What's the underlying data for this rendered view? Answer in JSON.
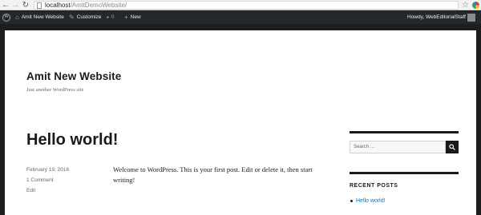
{
  "browser": {
    "url_host": "localhost",
    "url_path": "/AmitDemoWebsite/",
    "back_icon": "back-arrow-icon",
    "forward_icon": "forward-arrow-icon",
    "reload_icon": "reload-icon",
    "star_icon": "bookmark-star-icon"
  },
  "adminbar": {
    "site_name": "Amit New Website",
    "customize": "Customize",
    "comments_count": "0",
    "new": "New",
    "howdy": "Howdy, WebEditorialStaff"
  },
  "site": {
    "title": "Amit New Website",
    "description": "Just another WordPress site"
  },
  "post": {
    "title": "Hello world!",
    "date": "February 19, 2016",
    "comments": "1 Comment",
    "edit": "Edit",
    "content": "Welcome to WordPress. This is your first post. Edit or delete it, then start writing!"
  },
  "sidebar": {
    "search_placeholder": "Search …",
    "recent_posts_title": "RECENT POSTS",
    "recent_posts": [
      "Hello world!"
    ]
  },
  "colors": {
    "adminbar_bg": "#23282d",
    "link": "#007acc",
    "text": "#1a1a1a"
  }
}
